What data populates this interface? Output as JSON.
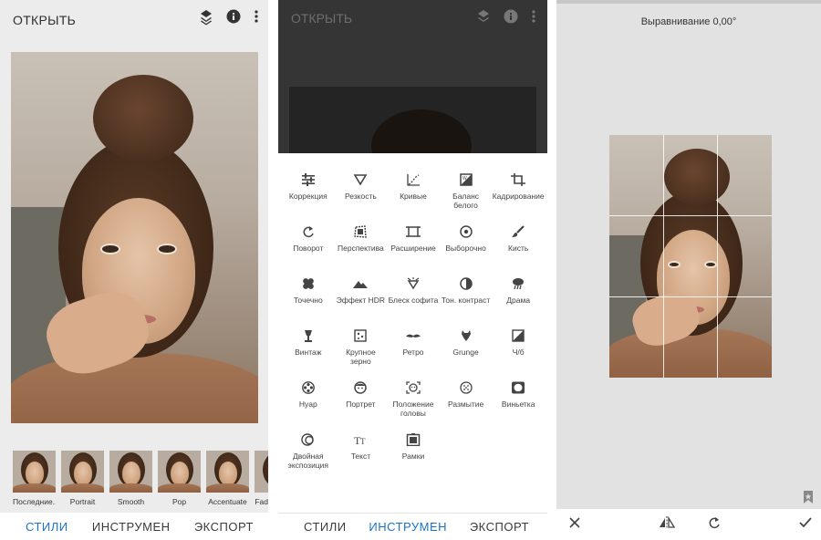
{
  "panel1": {
    "open_label": "ОТКРЫТЬ",
    "icons": [
      "layers-icon",
      "info-icon",
      "more-vert-icon"
    ],
    "thumbnails": [
      {
        "label": "Последние..."
      },
      {
        "label": "Portrait"
      },
      {
        "label": "Smooth"
      },
      {
        "label": "Pop"
      },
      {
        "label": "Accentuate"
      },
      {
        "label": "Fade"
      }
    ],
    "nav": {
      "styles": "СТИЛИ",
      "tools": "ИНСТРУМЕН",
      "export": "ЭКСПОРТ",
      "active": "styles"
    }
  },
  "panel2": {
    "open_label": "ОТКРЫТЬ",
    "tools": [
      {
        "label": "Коррекция",
        "icon": "tune-icon"
      },
      {
        "label": "Резкость",
        "icon": "sharpness-icon"
      },
      {
        "label": "Кривые",
        "icon": "curves-icon"
      },
      {
        "label": "Баланс белого",
        "icon": "white-balance-icon"
      },
      {
        "label": "Кадрирование",
        "icon": "crop-icon"
      },
      {
        "label": "Поворот",
        "icon": "rotate-icon"
      },
      {
        "label": "Перспектива",
        "icon": "perspective-icon"
      },
      {
        "label": "Расширение",
        "icon": "expand-icon"
      },
      {
        "label": "Выборочно",
        "icon": "selective-icon"
      },
      {
        "label": "Кисть",
        "icon": "brush-icon"
      },
      {
        "label": "Точечно",
        "icon": "healing-icon"
      },
      {
        "label": "Эффект HDR",
        "icon": "hdr-icon"
      },
      {
        "label": "Блеск софита",
        "icon": "glamour-glow-icon"
      },
      {
        "label": "Тон. контраст",
        "icon": "tonal-contrast-icon"
      },
      {
        "label": "Драма",
        "icon": "drama-icon"
      },
      {
        "label": "Винтаж",
        "icon": "vintage-icon"
      },
      {
        "label": "Крупное зерно",
        "icon": "grainy-film-icon"
      },
      {
        "label": "Ретро",
        "icon": "retrolux-icon"
      },
      {
        "label": "Grunge",
        "icon": "grunge-icon"
      },
      {
        "label": "Ч/б",
        "icon": "black-white-icon"
      },
      {
        "label": "Нуар",
        "icon": "noir-icon"
      },
      {
        "label": "Портрет",
        "icon": "portrait-icon"
      },
      {
        "label": "Положение головы",
        "icon": "head-pose-icon"
      },
      {
        "label": "Размытие",
        "icon": "blur-icon"
      },
      {
        "label": "Виньетка",
        "icon": "vignette-icon"
      },
      {
        "label": "Двойная экспозиция",
        "icon": "double-exposure-icon"
      },
      {
        "label": "Текст",
        "icon": "text-icon"
      },
      {
        "label": "Рамки",
        "icon": "frames-icon"
      }
    ],
    "nav": {
      "styles": "СТИЛИ",
      "tools": "ИНСТРУМЕН",
      "export": "ЭКСПОРТ",
      "active": "tools"
    }
  },
  "panel3": {
    "alignment_label": "Выравнивание 0,00°",
    "bottom_icons": [
      "close-icon",
      "flip-icon",
      "rotate-icon",
      "check-icon"
    ],
    "corner_icon": "bookmark-icon"
  },
  "colors": {
    "accent": "#1a73c9",
    "text": "#333333",
    "background": "#ececec"
  }
}
